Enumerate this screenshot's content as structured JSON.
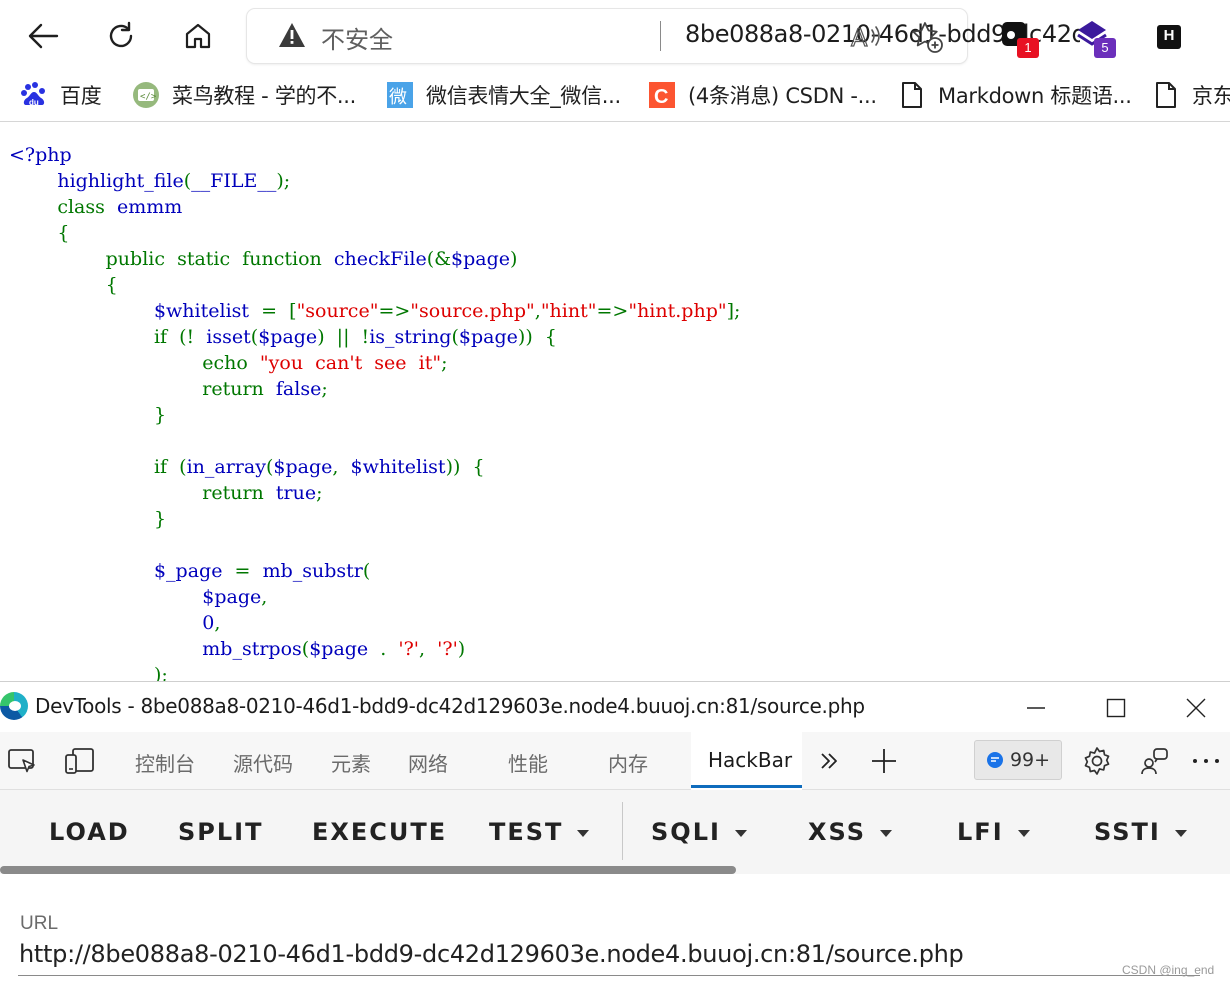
{
  "browser": {
    "security_label": "不安全",
    "address_url": "8be088a8-0210-46d1-bdd9-dc42d...",
    "extensions": [
      {
        "name": "extension-1",
        "badge": "1",
        "badge_color": "#e81123"
      },
      {
        "name": "extension-2",
        "badge": "5",
        "badge_color": "#6b2fbb"
      },
      {
        "name": "hackbar-extension",
        "badge": "H"
      }
    ]
  },
  "bookmarks": [
    {
      "label": "百度",
      "icon": "baidu-icon"
    },
    {
      "label": "菜鸟教程 - 学的不...",
      "icon": "runoob-icon"
    },
    {
      "label": "微信表情大全_微信...",
      "icon": "weixin-icon"
    },
    {
      "label": "(4条消息) CSDN -...",
      "icon": "csdn-icon"
    },
    {
      "label": "Markdown 标题语...",
      "icon": "document-icon"
    },
    {
      "label": "京东",
      "icon": "document-icon"
    }
  ],
  "code": {
    "open_tag": "<?php",
    "l2_fn": "highlight_file",
    "l2_p1": "(",
    "l2_const": "__FILE__",
    "l2_p2": ");",
    "l3_kw": "class",
    "l3_name": "emmm",
    "l4": "{",
    "l5_kw": "public  static  function",
    "l5_fn": "checkFile",
    "l5_p1": "(&",
    "l5_var": "$page",
    "l5_p2": ")",
    "l6": "{",
    "l7_var": "$whitelist",
    "l7_op": "=  [",
    "l7_s1": "\"source\"",
    "l7_a1": "=>",
    "l7_s2": "\"source.php\"",
    "l7_c1": ",",
    "l7_s3": "\"hint\"",
    "l7_a2": "=>",
    "l7_s4": "\"hint.php\"",
    "l7_end": "];",
    "l8_kw": "if  (!",
    "l8_fn1": "isset",
    "l8_p1": "(",
    "l8_var1": "$page",
    "l8_op": ")  ||  !",
    "l8_fn2": "is_string",
    "l8_p2": "(",
    "l8_var2": "$page",
    "l8_end": "))  {",
    "l9_kw": "echo",
    "l9_str": "\"you  can't  see  it\"",
    "l9_end": ";",
    "l10_kw": "return",
    "l10_val": "false",
    "l10_end": ";",
    "l11": "}",
    "l13_kw": "if  (",
    "l13_fn": "in_array",
    "l13_p1": "(",
    "l13_var1": "$page",
    "l13_c": ",  ",
    "l13_var2": "$whitelist",
    "l13_end": "))  {",
    "l14_kw": "return",
    "l14_val": "true",
    "l14_end": ";",
    "l15": "}",
    "l17_var": "$_page",
    "l17_op": "=",
    "l17_fn": "mb_substr",
    "l17_p": "(",
    "l18_var": "$page",
    "l18_c": ",",
    "l19_num": "0",
    "l19_c": ",",
    "l20_fn": "mb_strpos",
    "l20_p1": "(",
    "l20_var": "$page",
    "l20_dot": "  .  ",
    "l20_s1": "'?'",
    "l20_c": ",  ",
    "l20_s2": "'?'",
    "l20_p2": ")",
    "l21": ");"
  },
  "devtools": {
    "title": "DevTools - 8be088a8-0210-46d1-bdd9-dc42d129603e.node4.buuoj.cn:81/source.php",
    "tabs": [
      "控制台",
      "源代码",
      "元素",
      "网络",
      "性能",
      "内存",
      "HackBar"
    ],
    "active_tab": "HackBar",
    "issues_count": "99+"
  },
  "hackbar": {
    "buttons": [
      "LOAD",
      "SPLIT",
      "EXECUTE",
      "TEST",
      "SQLI",
      "XSS",
      "LFI",
      "SSTI"
    ],
    "url_label": "URL",
    "url_value": "http://8be088a8-0210-46d1-bdd9-dc42d129603e.node4.buuoj.cn:81/source.php"
  },
  "watermark": "CSDN @ing_end"
}
